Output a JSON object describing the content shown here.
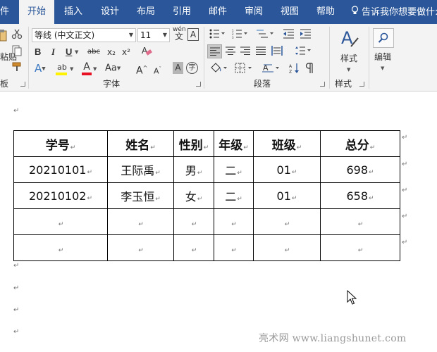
{
  "menu": {
    "partial": "件",
    "tabs": [
      "开始",
      "插入",
      "设计",
      "布局",
      "引用",
      "邮件",
      "审阅",
      "视图",
      "帮助"
    ],
    "active_tab": "开始",
    "tell_me": "告诉我你想要做什么"
  },
  "ribbon": {
    "clipboard": {
      "paste_label": "粘贴",
      "group_label": "板"
    },
    "font": {
      "font_name": "等线 (中文正文)",
      "font_size": "11",
      "pinyin_label": "wén",
      "group_label": "字体",
      "buttons": {
        "bold": "B",
        "italic": "I",
        "underline": "U",
        "strikethrough": "abc",
        "subscript": "x₂",
        "superscript": "x²",
        "change_case": "Aa",
        "grow": "A",
        "shrink": "A",
        "char_shading": "A",
        "enclose": "字",
        "border_char": "A",
        "highlight": "ab",
        "font_color": "A",
        "text_effect": "A"
      }
    },
    "paragraph": {
      "group_label": "段落"
    },
    "styles": {
      "label": "样式",
      "group_label": "样式"
    },
    "editing": {
      "label": "编辑"
    }
  },
  "table": {
    "headers": [
      "学号",
      "姓名",
      "性别",
      "年级",
      "班级",
      "总分"
    ],
    "rows": [
      [
        "20210101",
        "王际禹",
        "男",
        "二",
        "01",
        "698"
      ],
      [
        "20210102",
        "李玉恒",
        "女",
        "二",
        "01",
        "658"
      ],
      [
        "",
        "",
        "",
        "",
        "",
        ""
      ],
      [
        "",
        "",
        "",
        "",
        "",
        ""
      ]
    ]
  },
  "paragraph_mark": "↵",
  "watermark": "亮术网 www.liangshunet.com"
}
